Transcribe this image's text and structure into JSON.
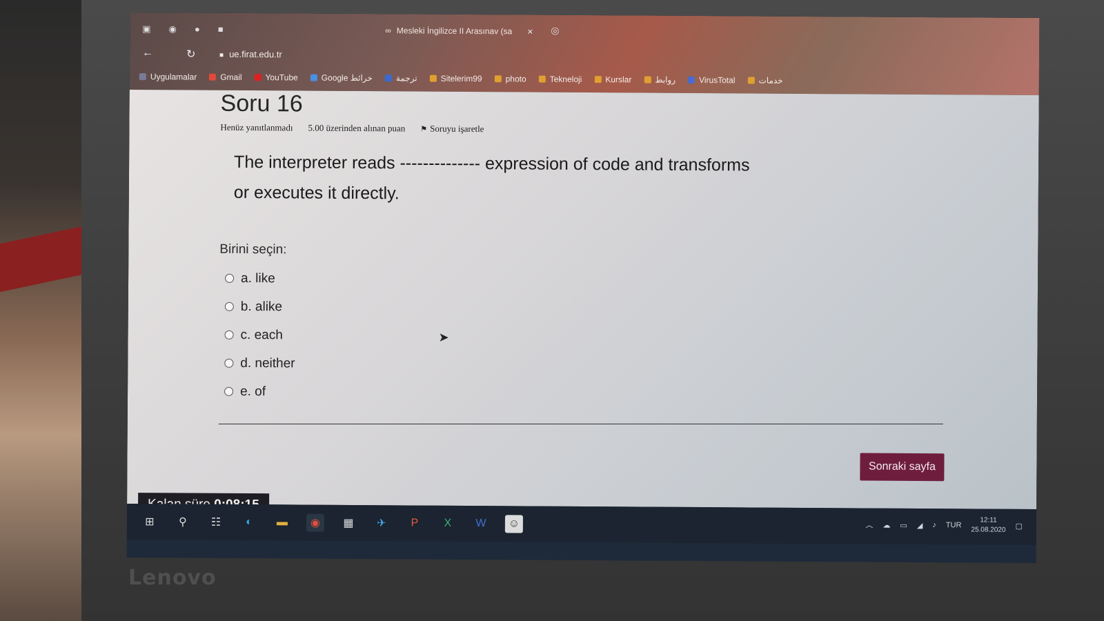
{
  "browser": {
    "tab_title": "Mesleki İngilizce II Arasınav (sa",
    "tab_close": "×",
    "url": "ue.firat.edu.tr",
    "bookmarks": [
      {
        "label": "Uygulamalar",
        "color": "#7a7a9a"
      },
      {
        "label": "Gmail",
        "color": "#e04a3a"
      },
      {
        "label": "YouTube",
        "color": "#e02020"
      },
      {
        "label": "Google خرائط",
        "color": "#4a90e2"
      },
      {
        "label": "ترجمة",
        "color": "#3a6ad0"
      },
      {
        "label": "Sitelerim99",
        "color": "#e0a030"
      },
      {
        "label": "photo",
        "color": "#e0a030"
      },
      {
        "label": "Tekneloji",
        "color": "#e0a030"
      },
      {
        "label": "Kurslar",
        "color": "#e0a030"
      },
      {
        "label": "روابط",
        "color": "#e0a030"
      },
      {
        "label": "VirusTotal",
        "color": "#4a6ad0"
      },
      {
        "label": "خدمات",
        "color": "#e0a030"
      }
    ]
  },
  "question": {
    "title": "Soru 16",
    "status": "Henüz yanıtlanmadı",
    "points": "5.00 üzerinden alınan puan",
    "flag_label": "Soruyu işaretle",
    "text": "The interpreter reads -------------- expression of code and transforms or executes it directly.",
    "choose_label": "Birini seçin:",
    "options": [
      "a. like",
      "b. alike",
      "c. each",
      "d. neither",
      "e. of"
    ]
  },
  "footer": {
    "next_button": "Sonraki sayfa",
    "timer_label": "Kalan süre",
    "timer_value": "0:08:15"
  },
  "taskbar": {
    "icons": [
      "windows-start-icon",
      "search-icon",
      "task-view-icon",
      "edge-icon",
      "file-explorer-icon",
      "chrome-icon",
      "store-icon",
      "telegram-icon",
      "powerpoint-icon",
      "excel-icon",
      "word-icon",
      "user-app-icon"
    ],
    "language": "TUR",
    "time": "12:11",
    "date": "25.08.2020"
  },
  "device": {
    "brand": "Lenovo"
  }
}
